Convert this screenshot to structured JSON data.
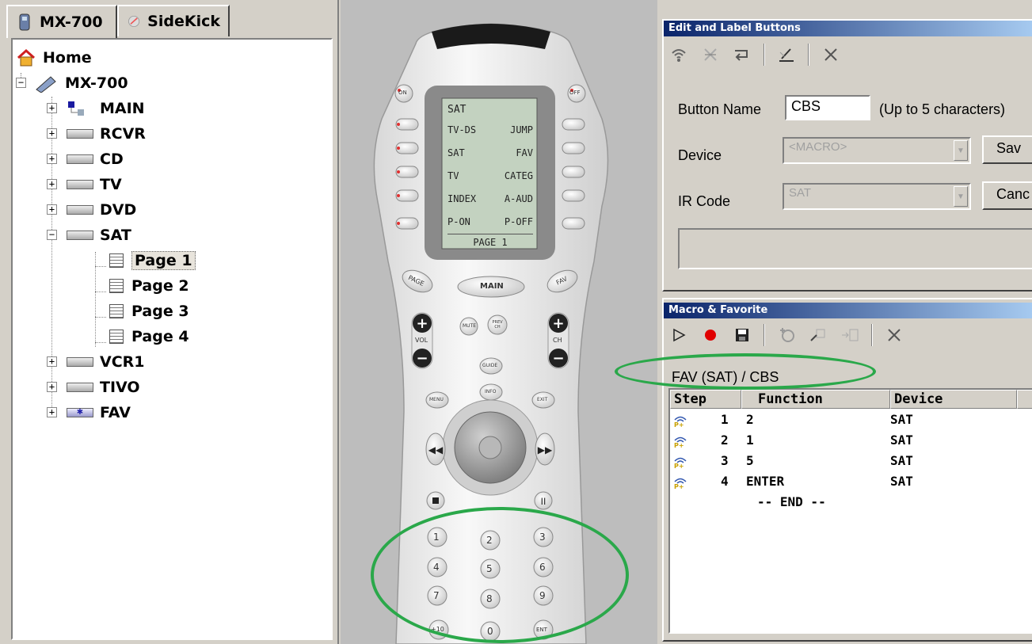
{
  "tabs": [
    {
      "label": "MX-700",
      "icon": "remote-icon",
      "active": true
    },
    {
      "label": "SideKick",
      "icon": "sidekick-icon",
      "active": false
    }
  ],
  "tree": {
    "home": "Home",
    "root": "MX-700",
    "devices": [
      "MAIN",
      "RCVR",
      "CD",
      "TV",
      "DVD",
      "SAT"
    ],
    "sat_pages": [
      "Page 1",
      "Page 2",
      "Page 3",
      "Page 4"
    ],
    "devices_after": [
      "VCR1",
      "TIVO",
      "FAV"
    ],
    "selected": "Page 1"
  },
  "remote": {
    "lcd": {
      "header": "SAT",
      "rows": [
        [
          "TV-DS",
          "JUMP"
        ],
        [
          "SAT",
          "FAV"
        ],
        [
          "TV",
          "CATEG"
        ],
        [
          "INDEX",
          "A-AUD"
        ],
        [
          "P-ON",
          "P-OFF"
        ]
      ],
      "footer": "PAGE 1"
    },
    "buttons": {
      "on": "ON",
      "off": "OFF",
      "page": "PAGE",
      "main": "MAIN",
      "fav": "FAV",
      "mute": "MUTE",
      "prev": "PREV CH",
      "vol": "VOL",
      "ch": "CH",
      "guide": "GUIDE",
      "menu": "MENU",
      "info": "INFO",
      "exit": "EXIT",
      "digits": [
        "1",
        "2",
        "3",
        "4",
        "5",
        "6",
        "7",
        "8",
        "9",
        "+10",
        "0",
        "ENT"
      ]
    }
  },
  "edit_panel": {
    "title": "Edit and Label Buttons",
    "button_name_label": "Button Name",
    "button_name_value": "CBS",
    "button_name_hint": "(Up to 5 characters)",
    "device_label": "Device",
    "device_value": "<MACRO>",
    "ir_code_label": "IR Code",
    "ir_code_value": "SAT",
    "save_label": "Sav",
    "cancel_label": "Canc"
  },
  "macro_panel": {
    "title": "Macro & Favorite",
    "macro_name": "FAV (SAT) / CBS",
    "columns": [
      "Step",
      "Function",
      "Device"
    ],
    "rows": [
      {
        "step": "1",
        "function": "2",
        "device": "SAT"
      },
      {
        "step": "2",
        "function": "1",
        "device": "SAT"
      },
      {
        "step": "3",
        "function": "5",
        "device": "SAT"
      },
      {
        "step": "4",
        "function": "ENTER",
        "device": "SAT"
      }
    ],
    "end_label": "-- END --"
  },
  "colors": {
    "highlight_ellipse": "#2aa84a",
    "titlebar": "#0a246a",
    "record": "#e00000"
  }
}
